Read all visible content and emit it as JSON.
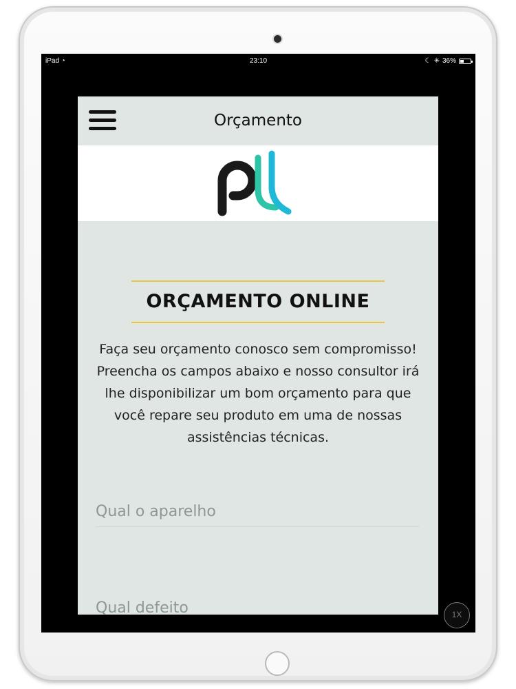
{
  "status_bar": {
    "device": "iPad",
    "time": "23:10",
    "battery": "36%",
    "battery_level": 0.36
  },
  "header": {
    "title": "Orçamento",
    "menu_icon": "hamburger-menu-icon"
  },
  "logo": {
    "letters": "pl",
    "colors": {
      "p": "#1a1a1a",
      "l1": "#2ec4a7",
      "l2": "#1fb8d6"
    }
  },
  "main": {
    "heading": "ORÇAMENTO ONLINE",
    "intro": "Faça seu orçamento conosco sem compromisso! Preencha os campos abaixo e nosso consultor irá lhe disponibilizar um bom orçamento para que você repare seu produto em uma de nossas assistências técnicas.",
    "fields": {
      "device_placeholder": "Qual o aparelho",
      "device_value": "",
      "defect_placeholder": "Qual defeito",
      "defect_value": ""
    }
  },
  "zoom": {
    "label": "1X"
  },
  "colors": {
    "app_background": "#dfe6e4",
    "accent_yellow": "#e8c640"
  }
}
